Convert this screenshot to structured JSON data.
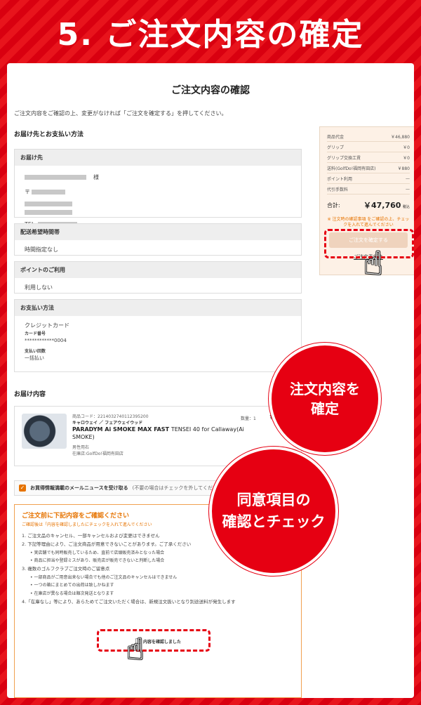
{
  "banner": {
    "title": "5. ご注文内容の確定"
  },
  "page": {
    "title": "ご注文内容の確認",
    "intro": "ご注文内容をご確認の上、変更がなければ「ご注文を確定する」を押してください。"
  },
  "delivery_payment": {
    "heading": "お届け先とお支払い方法",
    "address": {
      "label": "お届け先",
      "honorific": "様",
      "postal_prefix": "〒",
      "tel_prefix": "TEL:"
    },
    "time": {
      "label": "配送希望時間帯",
      "value": "時間指定なし"
    },
    "points": {
      "label": "ポイントのご利用",
      "value": "利用しない"
    },
    "payment": {
      "label": "お支払い方法",
      "method": "クレジットカード",
      "card_label": "カード番号",
      "card_number": "************0004",
      "installments_label": "支払い回数",
      "installments": "一括払い"
    }
  },
  "summary": {
    "rows": [
      {
        "label": "商品代金",
        "value": "￥46,880"
      },
      {
        "label": "グリップ",
        "value": "￥0"
      },
      {
        "label": "グリップ交換工賃",
        "value": "￥0"
      },
      {
        "label": "送料(GolfDo!福岡有田店)",
        "value": "￥880"
      },
      {
        "label": "ポイント利用",
        "value": "—"
      },
      {
        "label": "代引手数料",
        "value": "—"
      }
    ],
    "total_label": "合計:",
    "total_value": "￥47,760",
    "total_suffix": "税込",
    "note": "※ 注文時の確認事項 をご確認の上、チェックを入れて進んでください",
    "confirm_button": "ご注文を確定する",
    "procedure_link": "ご注文手続き"
  },
  "order": {
    "heading": "お届け内容",
    "product_code": "商品コード：2214032740112395200",
    "brand": "キャロウェイ",
    "category": "フェアウェイウッド",
    "name_bold": "PARADYM Ai SMOKE MAX FAST",
    "name_rest": "TENSEI 40 for Callaway(Ai SMOKE)",
    "spec": "男性用右",
    "store": "在庫店:GolfDo!福岡有田店",
    "qty": "数量：1",
    "price": "￥4"
  },
  "newsletter": {
    "label": "お買得情報満載のメールニュースを受け取る",
    "note": "(不要の場合はチェックを外してください)"
  },
  "agreement": {
    "heading": "ご注文前に下記内容をご確認ください",
    "sub": "ご確認後は「内容を確認しましたにチェックを入れて進んでください",
    "items": [
      {
        "text": "1. ご注文品のキャンセル、一部キャンセルおよび変更はできません",
        "bullet": false
      },
      {
        "text": "2. 下記等理由により、ご注文商品が用意できないことがあります。ご了承ください",
        "bullet": false
      },
      {
        "text": "実店舗でも同時販売しているため、直前で店頭販売済みとなった場合",
        "bullet": true
      },
      {
        "text": "商品に担当や登録ミスがあり、販売店が販売できないと判断した場合",
        "bullet": true
      },
      {
        "text": "3. 複数のゴルフクラブご注文時のご留意点",
        "bullet": false
      },
      {
        "text": "一部商品がご用意出来ない場合でも他のご注文品のキャンセルはできません",
        "bullet": true
      },
      {
        "text": "一つの箱にまとめての出荷は致しかねます",
        "bullet": true
      },
      {
        "text": "在庫店が異なる場合は順次発送となります",
        "bullet": true
      },
      {
        "text": "4.「在庫なし」等により、あらためてご注文いただく場合は、新規注文扱いとなり別途送料が発生します",
        "bullet": false
      }
    ],
    "checkbox_label": "内容を確認しました"
  },
  "callouts": {
    "confirm": [
      "注文内容を",
      "確定"
    ],
    "agree": [
      "同意項目の",
      "確認とチェック"
    ]
  }
}
